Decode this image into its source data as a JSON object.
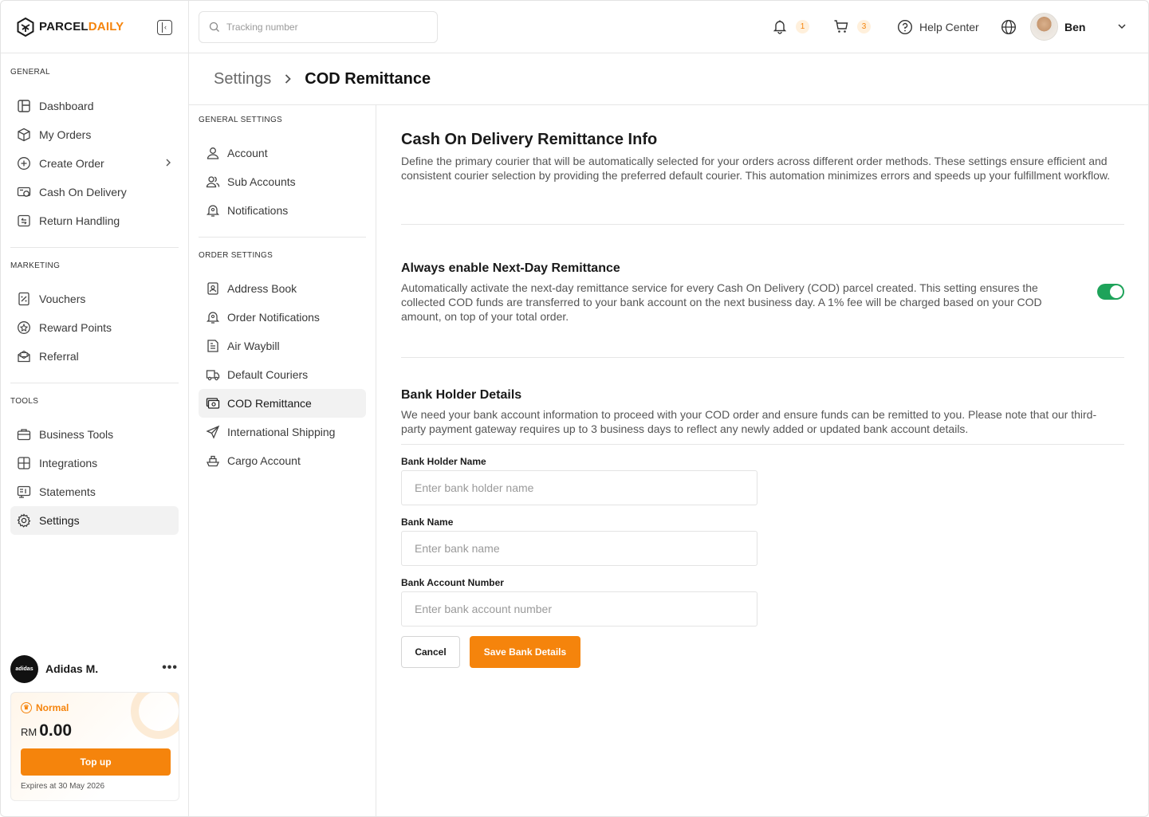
{
  "brand": {
    "part1": "PARCEL",
    "part2": "DAILY",
    "accent": "#f5840c"
  },
  "sidebar": {
    "general_label": "GENERAL",
    "general": [
      {
        "label": "Dashboard",
        "icon": "layout-icon"
      },
      {
        "label": "My Orders",
        "icon": "box-icon"
      },
      {
        "label": "Create Order",
        "icon": "plus-circle-icon"
      },
      {
        "label": "Cash On Delivery",
        "icon": "cash-icon"
      },
      {
        "label": "Return Handling",
        "icon": "return-icon"
      }
    ],
    "marketing_label": "MARKETING",
    "marketing": [
      {
        "label": "Vouchers",
        "icon": "voucher-icon"
      },
      {
        "label": "Reward Points",
        "icon": "reward-icon"
      },
      {
        "label": "Referral",
        "icon": "referral-icon"
      }
    ],
    "tools_label": "TOOLS",
    "tools": [
      {
        "label": "Business Tools",
        "icon": "briefcase-icon"
      },
      {
        "label": "Integrations",
        "icon": "integrations-icon"
      },
      {
        "label": "Statements",
        "icon": "statements-icon"
      },
      {
        "label": "Settings",
        "icon": "gear-icon"
      }
    ],
    "account": {
      "avatar_text": "adidas",
      "name": "Adidas M.",
      "more": "•••"
    },
    "wallet": {
      "tier": "Normal",
      "currency": "RM",
      "amount": "0.00",
      "topup_label": "Top up",
      "expires": "Expires at 30 May 2026"
    }
  },
  "topbar": {
    "search_placeholder": "Tracking number",
    "notifications_count": "1",
    "cart_count": "3",
    "help_label": "Help Center",
    "user_name": "Ben"
  },
  "breadcrumb": {
    "parent": "Settings",
    "separator": "›",
    "current": "COD Remittance"
  },
  "subnav": {
    "general_label": "GENERAL SETTINGS",
    "general": [
      {
        "label": "Account"
      },
      {
        "label": "Sub Accounts"
      },
      {
        "label": "Notifications"
      }
    ],
    "order_label": "ORDER SETTINGS",
    "order": [
      {
        "label": "Address Book"
      },
      {
        "label": "Order Notifications"
      },
      {
        "label": "Air Waybill"
      },
      {
        "label": "Default Couriers"
      },
      {
        "label": "COD Remittance"
      },
      {
        "label": "International Shipping"
      },
      {
        "label": "Cargo Account"
      }
    ]
  },
  "main": {
    "title": "Cash On Delivery Remittance Info",
    "description": "Define the primary courier that will be automatically selected for your orders across different order methods. These settings ensure efficient and consistent courier selection by providing the preferred default courier. This automation minimizes errors and speeds up your fulfillment workflow.",
    "next_day": {
      "title": "Always enable Next-Day Remittance",
      "description": "Automatically activate the next-day remittance service for every Cash On Delivery (COD) parcel created. This setting ensures the collected COD funds are transferred to your bank account on the next business day. A 1% fee will be charged based on your COD amount, on top of your total order.",
      "enabled": true,
      "toggle_color": "#1ea35a"
    },
    "bank": {
      "title": "Bank Holder Details",
      "description": "We need your bank account information to proceed with your COD order and ensure funds can be remitted to you. Please note that our third-party payment gateway requires up to 3 business days to reflect any newly added or updated bank account details.",
      "holder_label": "Bank Holder Name",
      "holder_placeholder": "Enter bank holder name",
      "bank_label": "Bank Name",
      "bank_placeholder": "Enter bank name",
      "account_label": "Bank Account Number",
      "account_placeholder": "Enter bank account number",
      "cancel_label": "Cancel",
      "save_label": "Save Bank Details"
    }
  }
}
